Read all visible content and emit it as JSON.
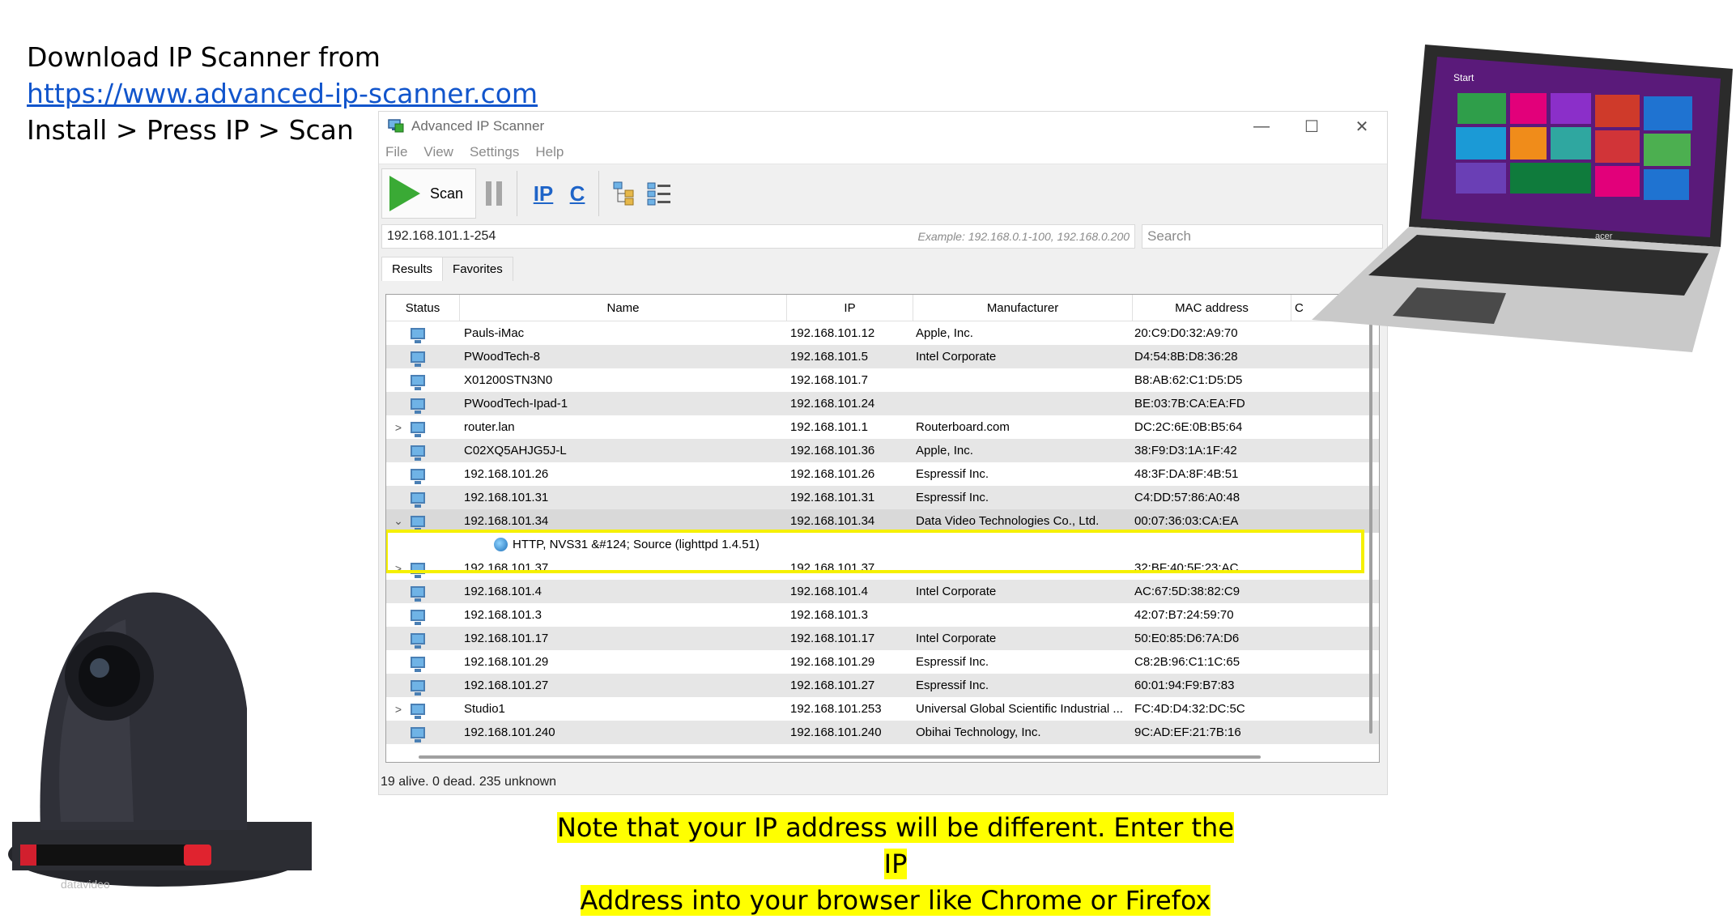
{
  "slide": {
    "line1": "Download IP Scanner from",
    "link": "https://www.advanced-ip-scanner.com",
    "line3": "Install > Press IP > Scan",
    "note_line1": "Note that your IP address will be different.  Enter the IP",
    "note_line2": "Address into your browser like Chrome or Firefox"
  },
  "window": {
    "title": "Advanced IP Scanner",
    "menu": [
      "File",
      "View",
      "Settings",
      "Help"
    ],
    "toolbar": {
      "scan_label": "Scan",
      "ip_label": "IP",
      "c_label": "C"
    },
    "range_value": "192.168.101.1-254",
    "range_example": "Example: 192.168.0.1-100, 192.168.0.200",
    "search_placeholder": "Search",
    "tabs": [
      "Results",
      "Favorites"
    ],
    "columns": [
      "Status",
      "Name",
      "IP",
      "Manufacturer",
      "MAC address",
      "C"
    ],
    "status_text": "19 alive. 0 dead. 235 unknown"
  },
  "rows": [
    {
      "expander": "",
      "name": "Pauls-iMac",
      "ip": "192.168.101.12",
      "manufacturer": "Apple, Inc.",
      "mac": "20:C9:D0:32:A9:70"
    },
    {
      "expander": "",
      "name": "PWoodTech-8",
      "ip": "192.168.101.5",
      "manufacturer": "Intel Corporate",
      "mac": "D4:54:8B:D8:36:28"
    },
    {
      "expander": "",
      "name": "X01200STN3N0",
      "ip": "192.168.101.7",
      "manufacturer": "",
      "mac": "B8:AB:62:C1:D5:D5"
    },
    {
      "expander": "",
      "name": "PWoodTech-Ipad-1",
      "ip": "192.168.101.24",
      "manufacturer": "",
      "mac": "BE:03:7B:CA:EA:FD"
    },
    {
      "expander": ">",
      "name": "router.lan",
      "ip": "192.168.101.1",
      "manufacturer": "Routerboard.com",
      "mac": "DC:2C:6E:0B:B5:64"
    },
    {
      "expander": "",
      "name": "C02XQ5AHJG5J-L",
      "ip": "192.168.101.36",
      "manufacturer": "Apple, Inc.",
      "mac": "38:F9:D3:1A:1F:42"
    },
    {
      "expander": "",
      "name": "192.168.101.26",
      "ip": "192.168.101.26",
      "manufacturer": "Espressif Inc.",
      "mac": "48:3F:DA:8F:4B:51"
    },
    {
      "expander": "",
      "name": "192.168.101.31",
      "ip": "192.168.101.31",
      "manufacturer": "Espressif Inc.",
      "mac": "C4:DD:57:86:A0:48"
    },
    {
      "expander": "⌄",
      "name": "192.168.101.34",
      "ip": "192.168.101.34",
      "manufacturer": "Data Video Technologies Co., Ltd.",
      "mac": "00:07:36:03:CA:EA"
    },
    {
      "expander": ">",
      "name": "192.168.101.37",
      "ip": "192.168.101.37",
      "manufacturer": "",
      "mac": "32:BF:40:5F:23:AC"
    },
    {
      "expander": "",
      "name": "192.168.101.4",
      "ip": "192.168.101.4",
      "manufacturer": "Intel Corporate",
      "mac": "AC:67:5D:38:82:C9"
    },
    {
      "expander": "",
      "name": "192.168.101.3",
      "ip": "192.168.101.3",
      "manufacturer": "",
      "mac": "42:07:B7:24:59:70"
    },
    {
      "expander": "",
      "name": "192.168.101.17",
      "ip": "192.168.101.17",
      "manufacturer": "Intel Corporate",
      "mac": "50:E0:85:D6:7A:D6"
    },
    {
      "expander": "",
      "name": "192.168.101.29",
      "ip": "192.168.101.29",
      "manufacturer": "Espressif Inc.",
      "mac": "C8:2B:96:C1:1C:65"
    },
    {
      "expander": "",
      "name": "192.168.101.27",
      "ip": "192.168.101.27",
      "manufacturer": "Espressif Inc.",
      "mac": "60:01:94:F9:B7:83"
    },
    {
      "expander": ">",
      "name": "Studio1",
      "ip": "192.168.101.253",
      "manufacturer": "Universal Global Scientific Industrial ...",
      "mac": "FC:4D:D4:32:DC:5C"
    },
    {
      "expander": "",
      "name": "192.168.101.240",
      "ip": "192.168.101.240",
      "manufacturer": "Obihai Technology, Inc.",
      "mac": "9C:AD:EF:21:7B:16"
    }
  ],
  "service_row": "HTTP, NVS31 &#124; Source (lighttpd 1.4.51)",
  "laptop": {
    "brand": "acer",
    "screen_label": "Start"
  },
  "camera": {
    "brand": "datavideo"
  },
  "colors": {
    "highlight": "#f5f000",
    "note_bg": "#ffff00",
    "link": "#1155cc",
    "scan_green": "#3aaa35"
  }
}
